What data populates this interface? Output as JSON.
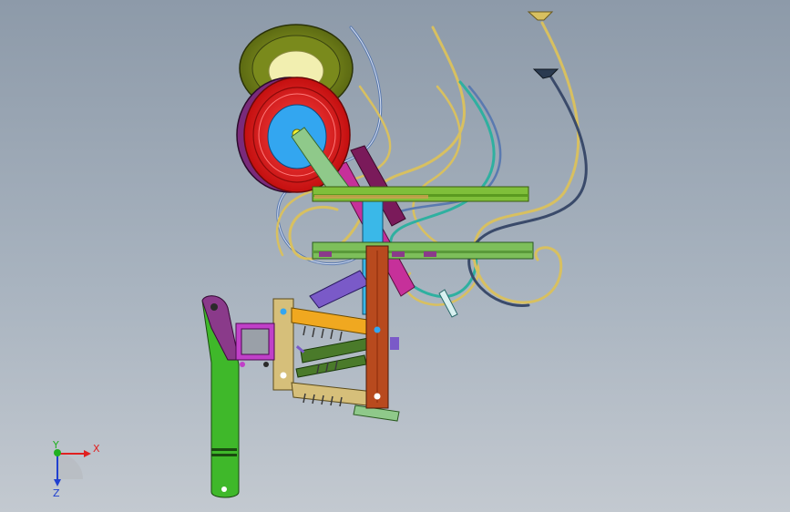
{
  "viewport": {
    "background_top": "#8d9aa9",
    "background_bottom": "#c3c9d0"
  },
  "triad": {
    "x_label": "X",
    "y_label": "Y",
    "z_label": "Z",
    "x_color": "#e02020",
    "y_color": "#20b020",
    "z_color": "#2040d0"
  },
  "parts": {
    "large_pulley_color": "#e01a1a",
    "large_pulley_hub_color": "#33a6f0",
    "back_pulley_color": "#7a8a1c",
    "back_pulley_face_color": "#f2efb0",
    "main_frame_color": "#b84a1e",
    "crank_arm_color": "#8fc98a",
    "link_arm_color": "#c6309a",
    "upper_rail_color": "#7fbf3a",
    "lower_rail_color": "#7dbf5a",
    "side_link_color": "#3fb82a",
    "mount_bracket_color": "#8a3a8a",
    "pipe_color_a": "#d8c060",
    "pipe_color_b": "#5a7ab0",
    "pipe_color_c": "#2fb0a0",
    "pipe_color_d": "#c0b050"
  }
}
